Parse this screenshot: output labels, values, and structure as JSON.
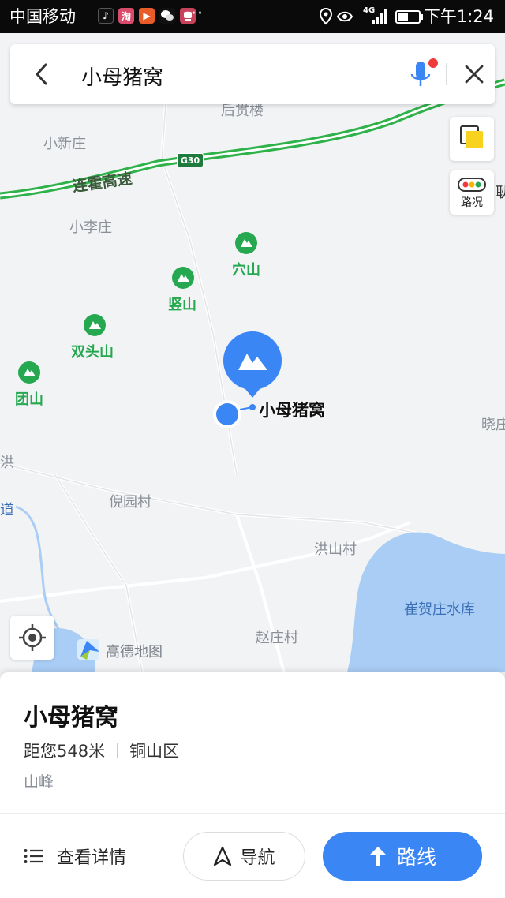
{
  "status_bar": {
    "carrier": "中国移动",
    "network": "4G",
    "time": "下午1:24",
    "more": "···"
  },
  "search": {
    "query": "小母猪窝"
  },
  "map": {
    "labels": {
      "xinzhuang": "小新庄",
      "lizhuang": "小李庄",
      "nigeyuan": "倪园村",
      "hongshan_village": "洪山村",
      "zhaozhuang": "赵庄村",
      "xiaozhuang_right": "晓庄",
      "hong_left": "洪",
      "dao_left": "道",
      "top_village": "后贯楼",
      "lian_right": "耿"
    },
    "road": {
      "name": "连霍高速",
      "shield": "G30"
    },
    "pois": {
      "xueshan": "穴山",
      "shushan": "竖山",
      "shuangtoushan": "双头山",
      "tuanshan": "团山"
    },
    "water": "崔贺庄水库",
    "target_label": "小母猪窝",
    "traffic_label": "路况",
    "brand": "高德地图"
  },
  "place": {
    "name": "小母猪窝",
    "distance": "距您548米",
    "district": "铜山区",
    "category": "山峰"
  },
  "actions": {
    "details": "查看详情",
    "navigate": "导航",
    "route": "路线"
  },
  "colors": {
    "accent": "#3b86f5",
    "poi_green": "#25a84f",
    "highway_green": "#2fb24a",
    "water": "#a9cdf5"
  }
}
